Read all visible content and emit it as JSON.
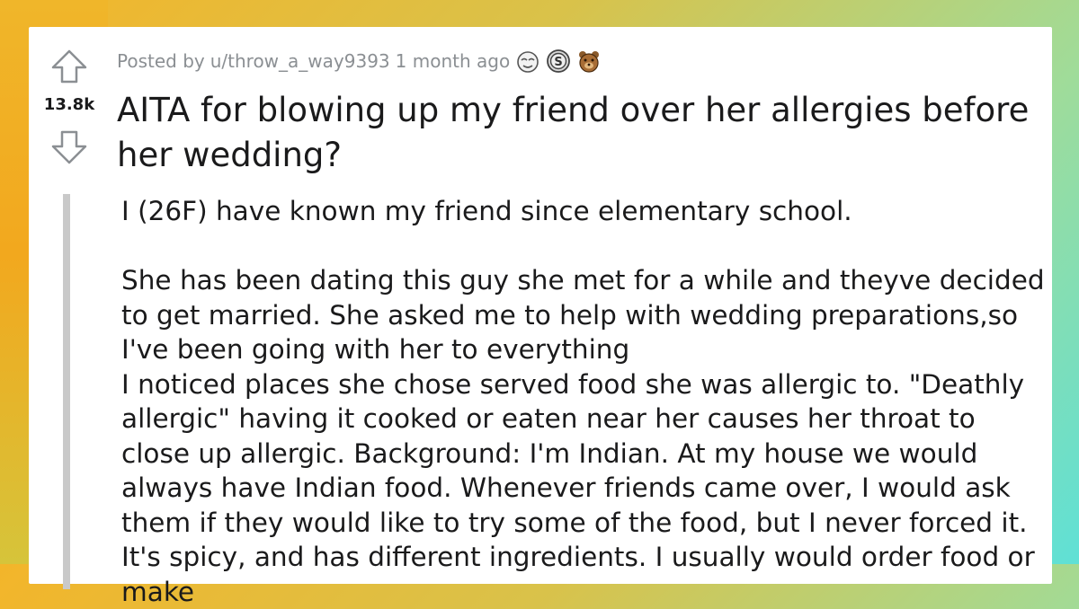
{
  "post": {
    "posted_prefix": "Posted by",
    "username": "u/throw_a_way9393",
    "time_ago": "1 month ago",
    "awards": [
      {
        "icon": "face-award-icon"
      },
      {
        "icon": "silver-coin-award-icon"
      },
      {
        "icon": "bear-award-icon"
      }
    ],
    "score": "13.8k",
    "title": "AITA for blowing up my friend over her allergies before her wedding?",
    "paragraphs": [
      "I (26F) have known my friend since elementary school.",
      "She has been dating this guy she met for a while and theyve decided to get married. She asked me to help with wedding preparations,so I've been going with her to everything",
      "I noticed places she chose served food she was allergic to. \"Deathly allergic\" having it cooked or eaten near her causes her throat to close up allergic. Background: I'm Indian. At my house we would always have Indian food. Whenever friends came over, I would ask them if they would like to try some of the food, but I never forced it. It's spicy, and has different ingredients. I usually would order food or make"
    ]
  },
  "colors": {
    "card_bg": "#ffffff",
    "text": "#1a1a1b",
    "meta_text": "#8b8f93",
    "quote_bar": "#c9c9c9"
  }
}
